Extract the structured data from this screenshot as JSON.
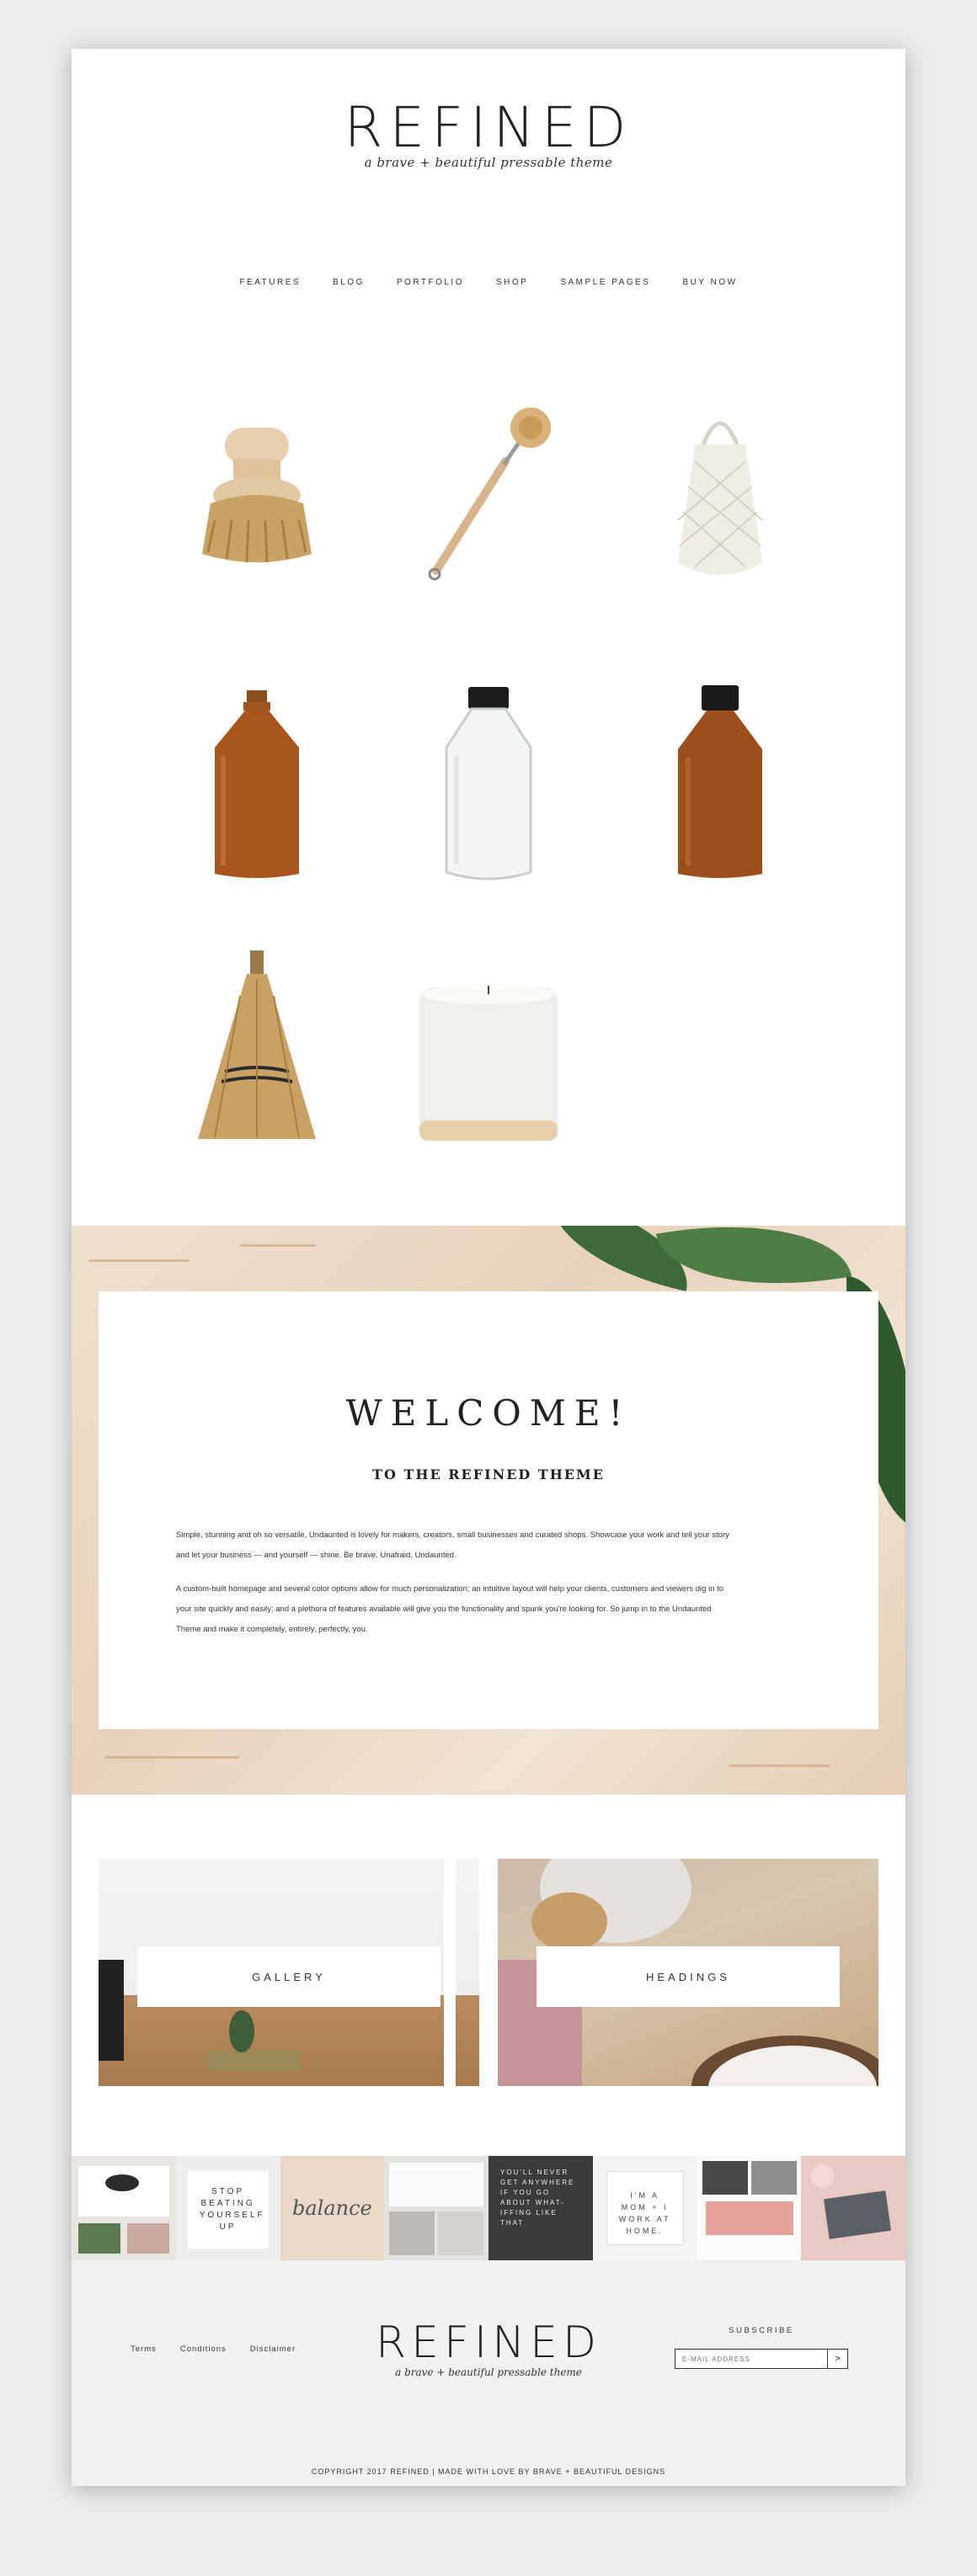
{
  "header": {
    "logo": "REFINED",
    "tagline": "a brave + beautiful pressable theme"
  },
  "nav": [
    "FEATURES",
    "BLOG",
    "PORTFOLIO",
    "SHOP",
    "SAMPLE PAGES",
    "BUY NOW"
  ],
  "products": [
    {
      "icon": "pot-brush-icon"
    },
    {
      "icon": "dish-brush-icon"
    },
    {
      "icon": "mesh-bag-icon"
    },
    {
      "icon": "amber-bottle-icon"
    },
    {
      "icon": "clear-bottle-icon"
    },
    {
      "icon": "amber-bottle-cap-icon"
    },
    {
      "icon": "whisk-broom-icon"
    },
    {
      "icon": "candle-icon"
    }
  ],
  "welcome": {
    "title": "WELCOME!",
    "subtitle": "TO THE REFINED THEME",
    "p1a": "Simple, stunning and oh so versatile, Undaunted is lovely for makers, creators, small businesses and curated shops. Showcase your work and tell your story",
    "p1b": "and let your business — and yourself — shine. Be brave. Unafraid. Undaunted.",
    "p2a": "A custom-built homepage and several color options allow for much personalization; an intuitive layout will help your clients, customers and viewers dig in to",
    "p2b": "your site quickly and easily; and a plethora of features available will give you the functionality and spunk you're looking for. So jump in to the Undaunted",
    "p2c": "Theme and make it completely, entirely, perfectly, you."
  },
  "cards": [
    {
      "label": "GALLERY"
    },
    {
      "label": "HEADINGS"
    }
  ],
  "strip": {
    "tile2": "STOP BEATING YOURSELF UP",
    "tile3": "balance",
    "tile5": "YOU'LL NEVER GET ANYWHERE IF YOU GO ABOUT WHAT-IFFING LIKE THAT",
    "tile6": "I'M A MOM + I WORK AT HOME."
  },
  "footer": {
    "links": [
      "Terms",
      "Conditions",
      "Disclaimer"
    ],
    "logo": "REFINED",
    "tagline": "a brave + beautiful pressable theme",
    "subscribe_title": "SUBSCRIBE",
    "email_placeholder": "E-MAIL ADDRESS",
    "submit": ">",
    "copyright": "COPYRIGHT 2017 REFINED | MADE WITH LOVE BY BRAVE + BEAUTIFUL DESIGNS"
  }
}
